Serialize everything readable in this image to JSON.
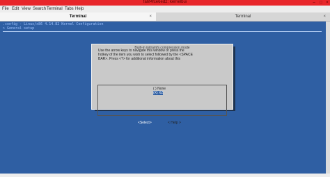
{
  "window": {
    "title": "fa6f4fce6ed2: kernelbui"
  },
  "menubar": {
    "items": [
      "File",
      "Edit",
      "View",
      "Search",
      "Terminal",
      "Tabs",
      "Help"
    ]
  },
  "tabs": [
    {
      "label": "Terminal",
      "active": true
    },
    {
      "label": "Terminal",
      "active": false
    }
  ],
  "terminal": {
    "path_line": ".config - Linux/x86 4.14.82 Kernel Configuration",
    "section_line": "> General setup"
  },
  "dialog": {
    "title": "Built-in initramfs compression mode",
    "help_text": "Use the arrow keys to navigate this window or press the\nhotkey of the item you wish to select followed by the <SPACE\nBAR>. Press <?> for additional information about this",
    "options": [
      {
        "label": "( ) None",
        "selected": false
      },
      {
        "label": "(X) XZ",
        "selected": true
      }
    ],
    "select_button": "<Select>",
    "help_button": "< Help >"
  },
  "colors": {
    "titlebar": "#e8262a",
    "terminal_bg": "#2f5fa3",
    "dialog_bg": "#c9c9c9"
  }
}
